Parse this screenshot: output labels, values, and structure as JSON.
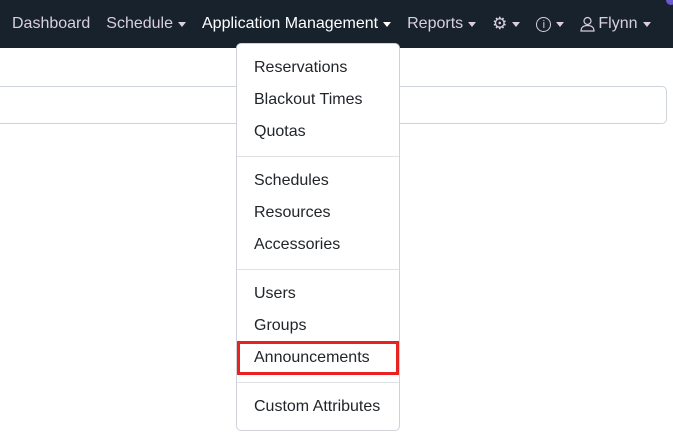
{
  "nav": {
    "items": [
      {
        "label": "Dashboard",
        "caret": false
      },
      {
        "label": "Schedule",
        "caret": true
      },
      {
        "label": "Application Management",
        "caret": true,
        "active": true
      },
      {
        "label": "Reports",
        "caret": true
      }
    ],
    "settings_icon": "gear-icon",
    "info_icon": "info-circle-icon",
    "user": {
      "icon": "user-icon",
      "label": "Flynn"
    }
  },
  "menu": {
    "groups": [
      [
        "Reservations",
        "Blackout Times",
        "Quotas"
      ],
      [
        "Schedules",
        "Resources",
        "Accessories"
      ],
      [
        "Users",
        "Groups",
        "Announcements"
      ],
      [
        "Custom Attributes"
      ]
    ],
    "highlighted": "Announcements",
    "highlight_color": "#e8221f"
  }
}
